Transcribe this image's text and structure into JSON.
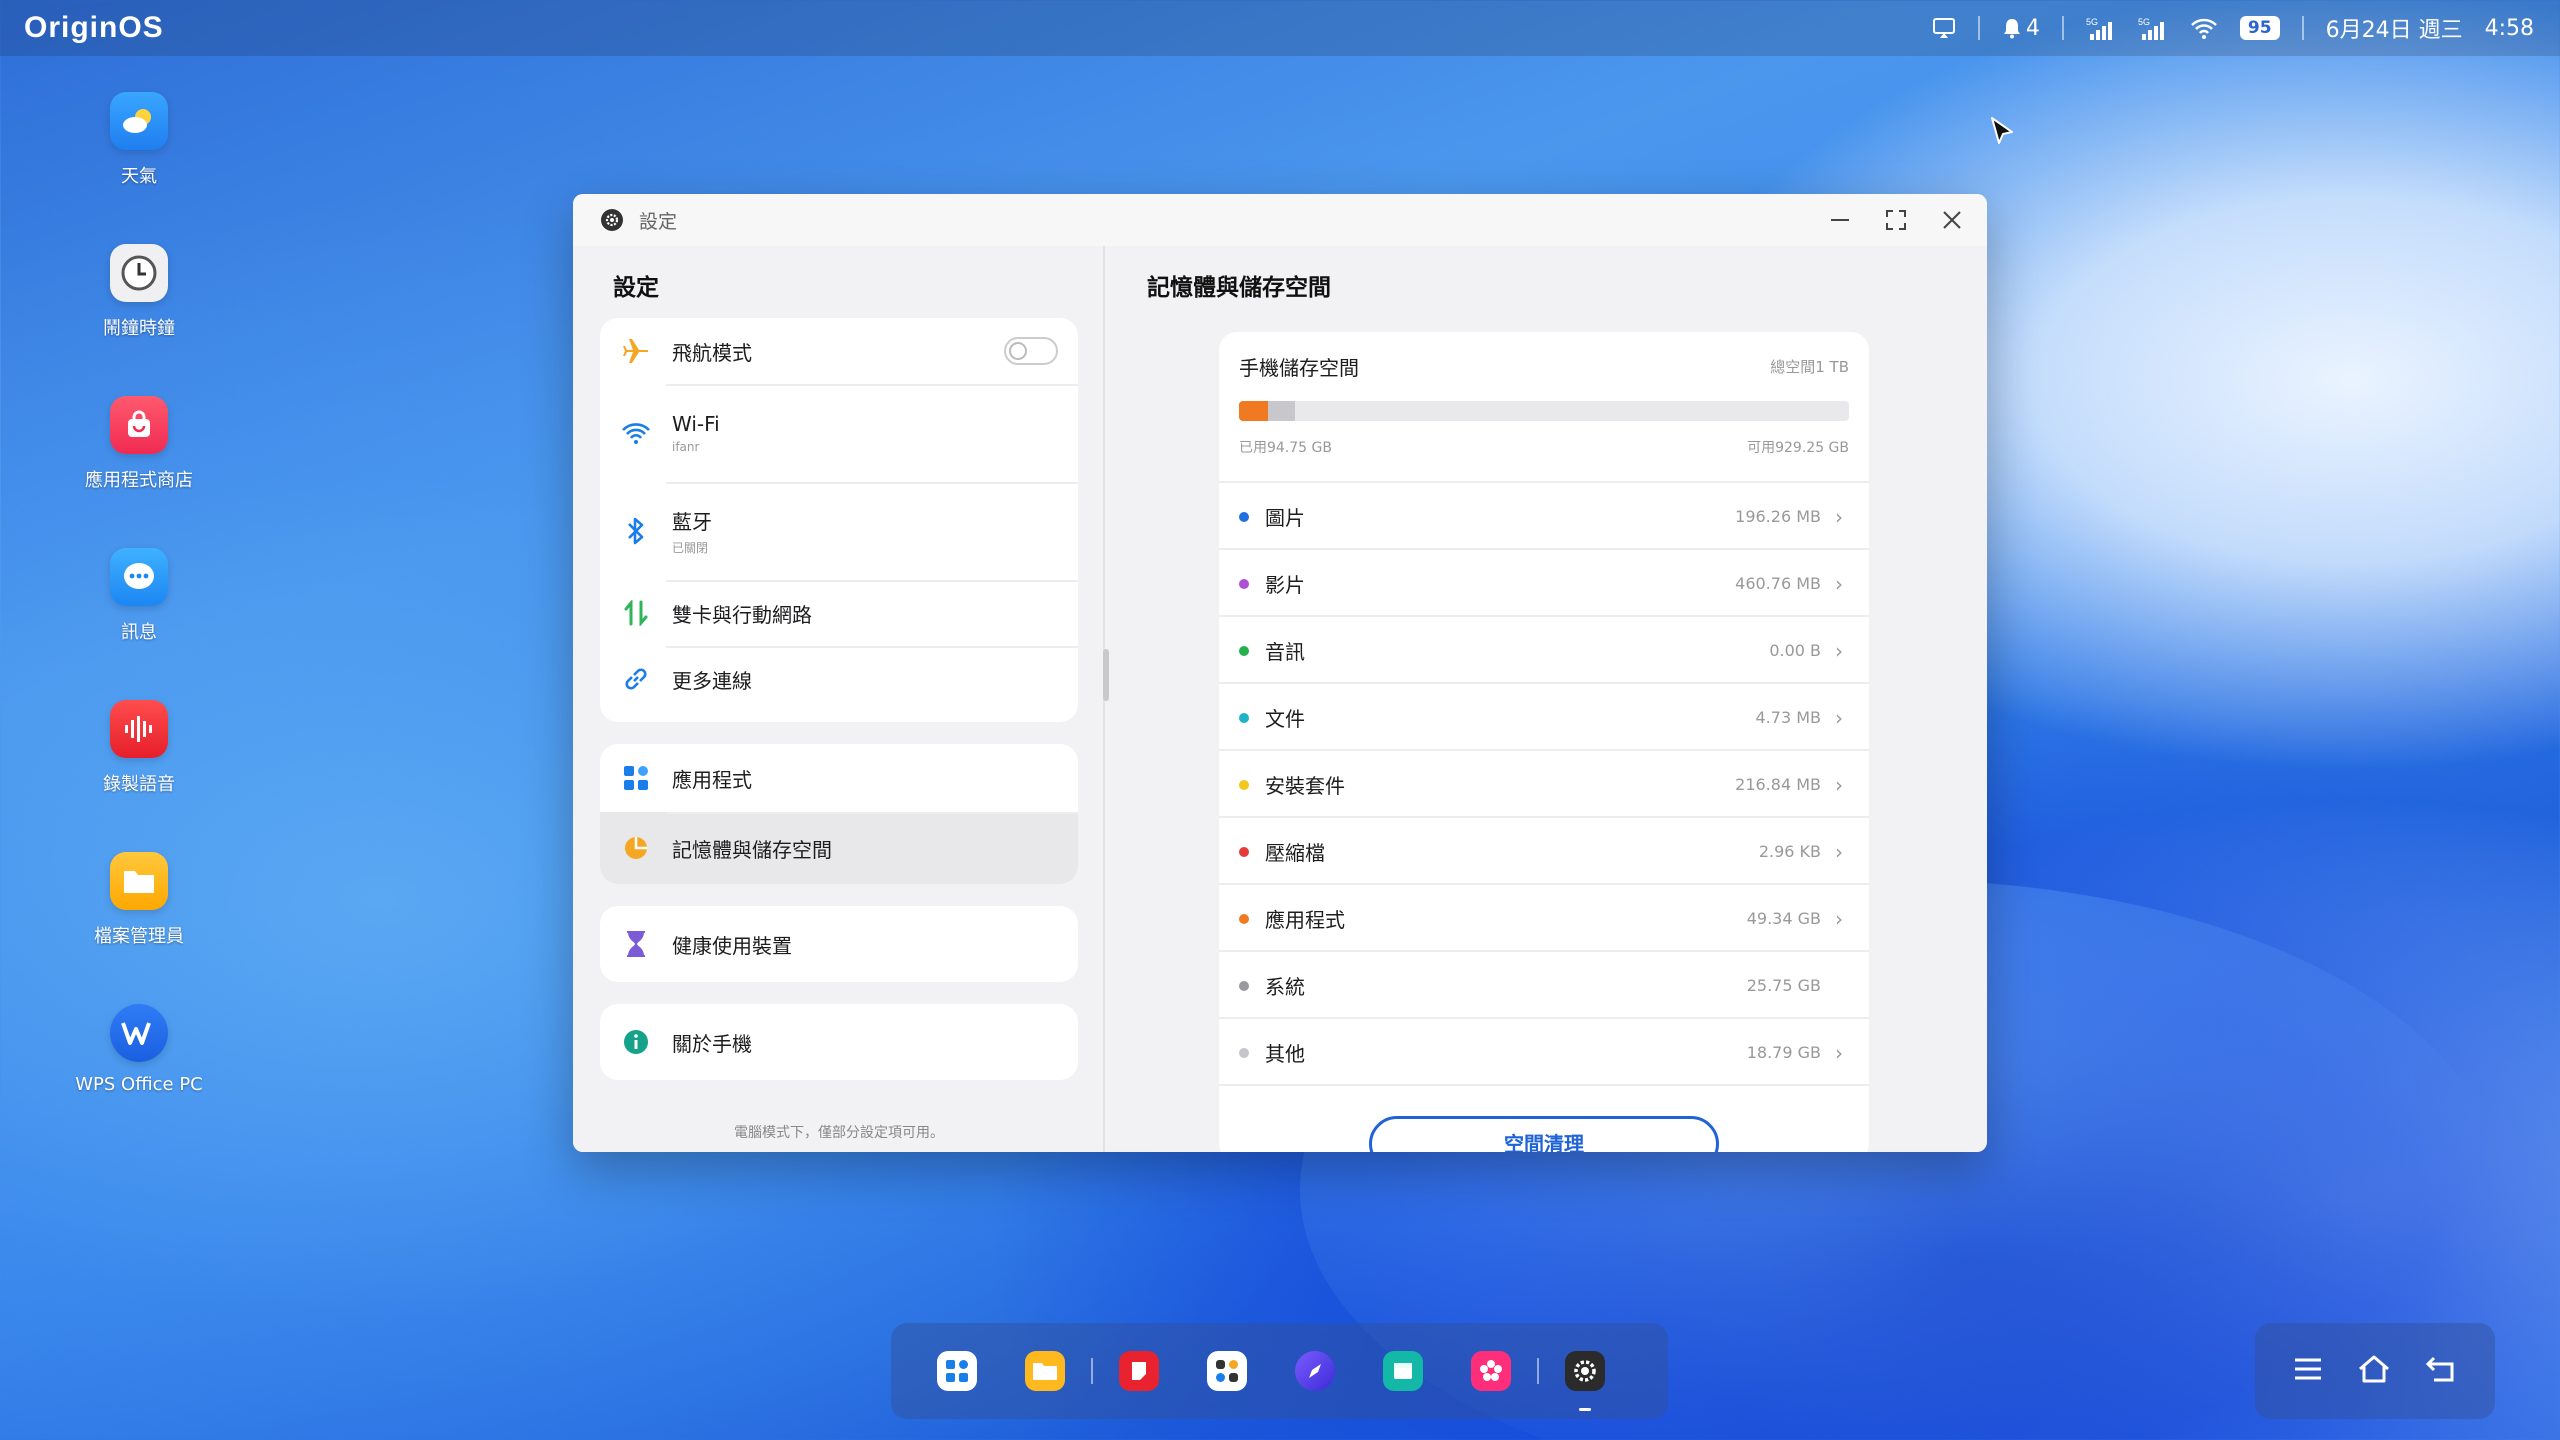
{
  "topbar": {
    "logo": "OriginOS",
    "notification_count": "4",
    "signal1": "5G",
    "signal2": "5G",
    "battery": "95",
    "datetime": "6月24日 週三",
    "time": "4:58"
  },
  "desktop": {
    "icons": [
      {
        "label": "天氣",
        "icon": "weather-icon"
      },
      {
        "label": "鬧鐘時鐘",
        "icon": "clock-icon"
      },
      {
        "label": "應用程式商店",
        "icon": "app-store-icon"
      },
      {
        "label": "訊息",
        "icon": "messages-icon"
      },
      {
        "label": "錄製語音",
        "icon": "voice-recorder-icon"
      },
      {
        "label": "檔案管理員",
        "icon": "file-manager-icon"
      },
      {
        "label": "WPS Office PC",
        "icon": "wps-office-icon"
      }
    ]
  },
  "window": {
    "title": "設定",
    "left": {
      "heading": "設定",
      "group1": [
        {
          "label": "飛航模式",
          "icon": "airplane-icon"
        },
        {
          "label": "Wi-Fi",
          "sub": "ifanr",
          "icon": "wifi-icon"
        },
        {
          "label": "藍牙",
          "sub": "已關閉",
          "icon": "bluetooth-icon"
        },
        {
          "label": "雙卡與行動網路",
          "icon": "mobile-network-icon"
        },
        {
          "label": "更多連線",
          "icon": "link-icon"
        }
      ],
      "group2": [
        {
          "label": "應用程式",
          "icon": "apps-icon"
        },
        {
          "label": "記憶體與儲存空間",
          "icon": "storage-icon"
        }
      ],
      "group3": [
        {
          "label": "健康使用裝置",
          "icon": "hourglass-icon"
        }
      ],
      "group4": [
        {
          "label": "關於手機",
          "icon": "info-icon"
        }
      ],
      "footnote": "電腦模式下，僅部分設定項可用。"
    },
    "right": {
      "heading": "記憶體與儲存空間",
      "storage": {
        "title": "手機儲存空間",
        "total": "總空間1 TB",
        "used": "已用94.75 GB",
        "available": "可用929.25 GB",
        "used_fraction_orange": 0.048,
        "used_fraction_gray": 0.044
      },
      "categories": [
        {
          "name": "圖片",
          "value": "196.26 MB",
          "color": "#1f6fe0",
          "chevron": true
        },
        {
          "name": "影片",
          "value": "460.76 MB",
          "color": "#b04fd3",
          "chevron": true
        },
        {
          "name": "音訊",
          "value": "0.00 B",
          "color": "#22b14c",
          "chevron": true
        },
        {
          "name": "文件",
          "value": "4.73 MB",
          "color": "#1fb3c8",
          "chevron": true
        },
        {
          "name": "安裝套件",
          "value": "216.84 MB",
          "color": "#f2c81e",
          "chevron": true
        },
        {
          "name": "壓縮檔",
          "value": "2.96 KB",
          "color": "#e53b3b",
          "chevron": true
        },
        {
          "name": "應用程式",
          "value": "49.34 GB",
          "color": "#f07a22",
          "chevron": true
        },
        {
          "name": "系統",
          "value": "25.75 GB",
          "color": "#9a9a9e",
          "chevron": false
        },
        {
          "name": "其他",
          "value": "18.79 GB",
          "color": "#c5c5c9",
          "chevron": true
        }
      ],
      "cleanup_label": "空間清理"
    }
  },
  "dock": {
    "apps": [
      "launcher-icon",
      "file-manager-icon",
      "notes-icon",
      "tools-icon",
      "browser-icon",
      "gallery-icon",
      "album-icon",
      "settings-icon"
    ]
  }
}
